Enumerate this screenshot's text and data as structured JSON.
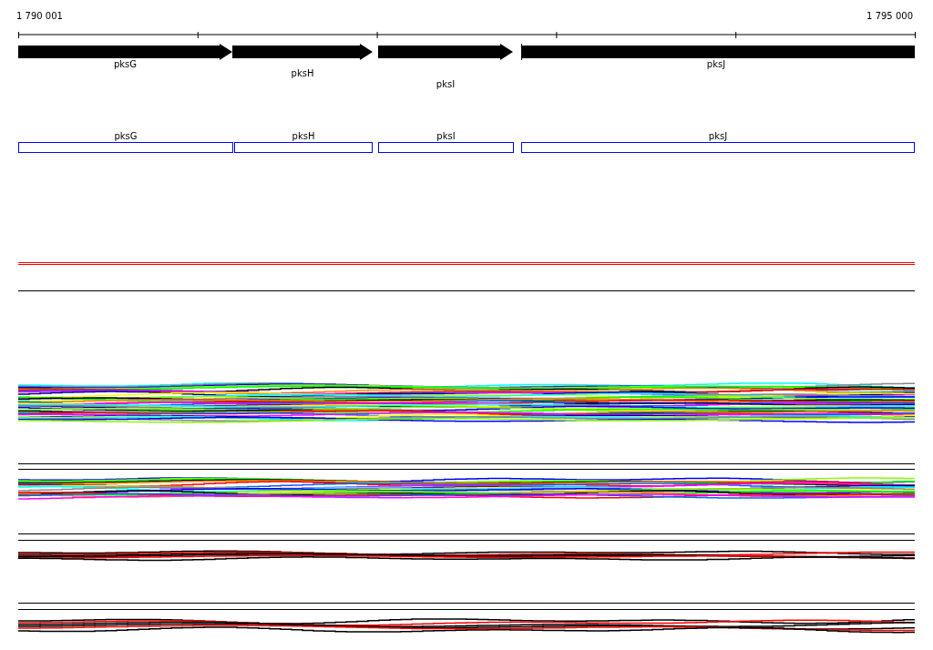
{
  "ruler": {
    "start_label": "1 790 001",
    "end_label": "1 795 000"
  },
  "gene_track": {
    "genes": [
      {
        "name": "pksG",
        "kind": "arrow"
      },
      {
        "name": "pksH",
        "kind": "arrow"
      },
      {
        "name": "pksI",
        "kind": "arrow"
      },
      {
        "name": "pksJ",
        "kind": "truncated"
      }
    ]
  },
  "feature_track": {
    "features": [
      {
        "label": "pksG"
      },
      {
        "label": "pksH"
      },
      {
        "label": "pksI"
      },
      {
        "label": "pksJ"
      }
    ]
  }
}
